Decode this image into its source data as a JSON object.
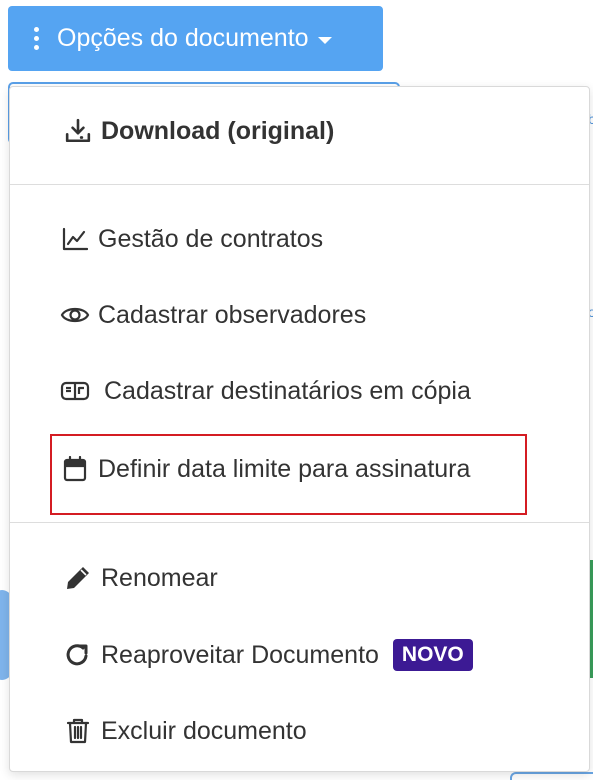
{
  "toolbar": {
    "options_label": "Opções do documento"
  },
  "menu": {
    "download_label": "Download (original)",
    "contracts_label": "Gestão de contratos",
    "observers_label": "Cadastrar observadores",
    "cc_recipients_label": "Cadastrar destinatários em cópia",
    "deadline_label": "Definir data limite para assinatura",
    "rename_label": "Renomear",
    "reuse_label": "Reaproveitar Documento",
    "reuse_badge": "NOVO",
    "delete_label": "Excluir documento"
  },
  "colors": {
    "button_bg": "#55a4f2",
    "text": "#333333",
    "highlight": "#d41c23",
    "badge_bg": "#3c1a94"
  },
  "icons": {
    "options": "vertical-ellipsis-icon",
    "download": "download-icon",
    "contracts": "line-chart-icon",
    "observers": "eye-icon",
    "cc_recipients": "mailbox-icon",
    "deadline": "calendar-icon",
    "rename": "pencil-icon",
    "reuse": "redo-icon",
    "delete": "trash-icon"
  }
}
